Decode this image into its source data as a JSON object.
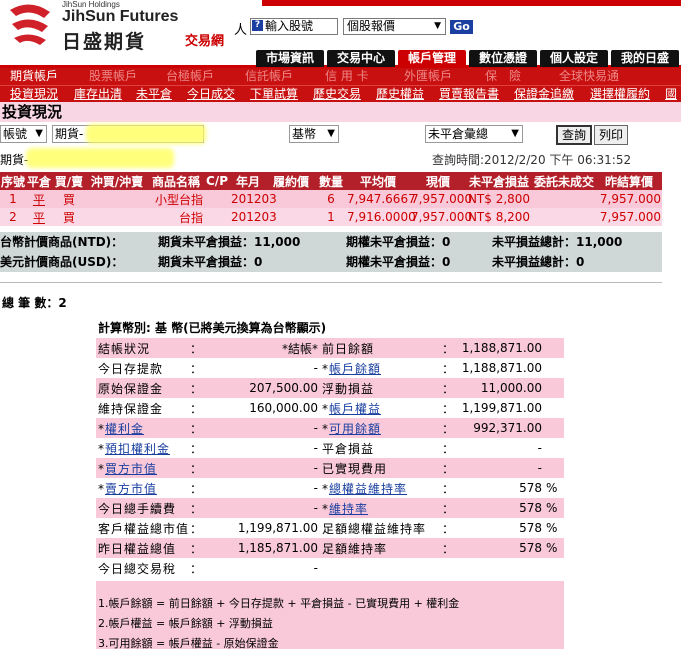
{
  "header": {
    "brand_small": "JihSun Holdings",
    "brand_en": "JihSun Futures",
    "brand_zh": "日盛期貨",
    "trade_net": "交易網",
    "user_prefix": "人",
    "search_placeholder": "輸入股號",
    "quote_select": "個股報價",
    "go_label": "Go"
  },
  "menu": [
    "市場資訊",
    "交易中心",
    "帳戶管理",
    "數位憑證",
    "個人設定",
    "我的日盛"
  ],
  "subnav1": [
    "期貨帳戶",
    "股票帳戶",
    "台極帳戶",
    "信託帳戶",
    "信 用 卡",
    "外匯帳戶",
    "保　險",
    "全球快易通"
  ],
  "subnav2": [
    "投資現況",
    "庫存出清",
    "未平倉",
    "今日成交",
    "下單試算",
    "歷史交易",
    "歷史權益",
    "買賣報告書",
    "保證金追繳",
    "選擇權履約",
    "國"
  ],
  "page_title": "投資現況",
  "filters": {
    "account_select": "帳號",
    "futures_select": "期貨-",
    "currency_select": "基幣",
    "type_select": "未平倉彙總",
    "query_button": "查詢",
    "print_button": "列印",
    "futures_label": "期貨-",
    "query_time": "查詢時間:2012/2/20 下午 06:31:52"
  },
  "positions": {
    "headers": [
      "序號",
      "平倉",
      "買/賣",
      "沖買/沖賣",
      "商品名稱",
      "C/P",
      "年月",
      "履約價",
      "數量",
      "平均價",
      "現價",
      "未平倉損益",
      "委託未成交",
      "昨結算價"
    ],
    "rows": [
      [
        "1",
        "平",
        "買",
        "",
        "小型台指",
        "",
        "201203",
        "",
        "6",
        "7,947.6667",
        "7,957.000",
        "NT$ 2,800",
        "",
        "7,957.000"
      ],
      [
        "2",
        "平",
        "買",
        "",
        "台指",
        "",
        "201203",
        "",
        "1",
        "7,916.0000",
        "7,957.000",
        "NT$ 8,200",
        "",
        "7,957.000"
      ]
    ]
  },
  "summary_ntd": {
    "label": "台幣計價商品(NTD)：",
    "futures": "期貨未平倉損益：11,000",
    "options": "期權未平倉損益：0",
    "total": "未平損益總計：11,000"
  },
  "summary_usd": {
    "label": "美元計價商品(USD)：",
    "futures": "期貨未平倉損益：0",
    "options": "期權未平倉損益：0",
    "total": "未平損益總計：0"
  },
  "total_count": "總 筆 數：2",
  "calc_title": "計算幣別: 基 幣(已將美元換算為台幣顯示)",
  "account": [
    [
      "結帳狀況",
      "*結帳*",
      "前日餘額",
      "1,188,871.00",
      false,
      false,
      ""
    ],
    [
      "今日存提款",
      "-",
      "帳戶餘額",
      "1,188,871.00",
      false,
      true,
      ""
    ],
    [
      "原始保證金",
      "207,500.00",
      "浮動損益",
      "11,000.00",
      false,
      false,
      ""
    ],
    [
      "維持保證金",
      "160,000.00",
      "帳戶權益",
      "1,199,871.00",
      false,
      true,
      ""
    ],
    [
      "權利金",
      "-",
      "可用餘額",
      "992,371.00",
      true,
      true,
      ""
    ],
    [
      "預扣權利金",
      "-",
      "平倉損益",
      "-",
      true,
      false,
      ""
    ],
    [
      "買方市值",
      "-",
      "已實現費用",
      "-",
      true,
      false,
      ""
    ],
    [
      "賣方市值",
      "-",
      "總權益維持率",
      "578",
      true,
      true,
      "%"
    ],
    [
      "今日總手續費",
      "-",
      "維持率",
      "578",
      false,
      true,
      "%"
    ],
    [
      "客戶權益總市值",
      "1,199,871.00",
      "足額總權益維持率",
      "578",
      false,
      false,
      "%"
    ],
    [
      "昨日權益總值",
      "1,185,871.00",
      "足額維持率",
      "578",
      false,
      false,
      "%"
    ],
    [
      "今日總交易稅",
      "-",
      "",
      "",
      false,
      false,
      ""
    ]
  ],
  "formulas": [
    "1.帳戶餘額 = 前日餘額 + 今日存提款 + 平倉損益 - 已實現費用 + 權利金",
    "2.帳戶權益 = 帳戶餘額 + 浮動損益",
    "3.可用餘額 = 帳戶權益 - 原始保證金"
  ]
}
